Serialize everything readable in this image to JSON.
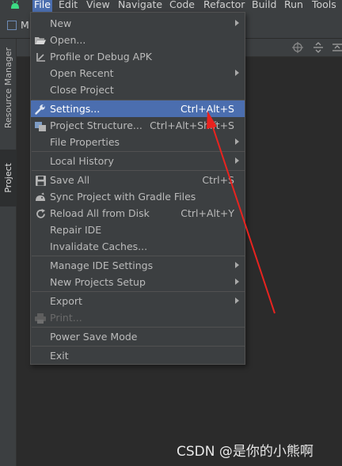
{
  "menubar": {
    "items": [
      {
        "label": "File"
      },
      {
        "label": "Edit"
      },
      {
        "label": "View"
      },
      {
        "label": "Navigate"
      },
      {
        "label": "Code"
      },
      {
        "label": "Refactor"
      },
      {
        "label": "Build"
      },
      {
        "label": "Run"
      },
      {
        "label": "Tools"
      }
    ]
  },
  "toolbar": {
    "project_label": "M"
  },
  "stripe": {
    "resource_manager": "Resource Manager",
    "project": "Project"
  },
  "file_menu": {
    "items": [
      {
        "label": "New",
        "submenu": true
      },
      {
        "label": "Open...",
        "icon": "folder-open-icon"
      },
      {
        "label": "Profile or Debug APK",
        "icon": "profile-apk-icon"
      },
      {
        "label": "Open Recent",
        "submenu": true
      },
      {
        "label": "Close Project"
      },
      {
        "label": "Settings...",
        "shortcut": "Ctrl+Alt+S",
        "icon": "wrench-icon",
        "highlighted": true
      },
      {
        "label": "Project Structure...",
        "shortcut": "Ctrl+Alt+Shift+S",
        "icon": "project-structure-icon"
      },
      {
        "label": "File Properties",
        "submenu": true
      },
      {
        "label": "Local History",
        "submenu": true
      },
      {
        "label": "Save All",
        "shortcut": "Ctrl+S",
        "icon": "save-icon"
      },
      {
        "label": "Sync Project with Gradle Files",
        "icon": "gradle-sync-icon"
      },
      {
        "label": "Reload All from Disk",
        "shortcut": "Ctrl+Alt+Y",
        "icon": "reload-icon"
      },
      {
        "label": "Repair IDE"
      },
      {
        "label": "Invalidate Caches..."
      },
      {
        "label": "Manage IDE Settings",
        "submenu": true
      },
      {
        "label": "New Projects Setup",
        "submenu": true
      },
      {
        "label": "Export",
        "submenu": true
      },
      {
        "label": "Print...",
        "icon": "print-icon",
        "disabled": true
      },
      {
        "label": "Power Save Mode"
      },
      {
        "label": "Exit"
      }
    ]
  },
  "watermark": "CSDN @是你的小熊啊",
  "colors": {
    "accent": "#4b6eaf",
    "annotation": "#e8231f",
    "menu_bg": "#3c3f41",
    "editor_bg": "#2b2b2b"
  }
}
